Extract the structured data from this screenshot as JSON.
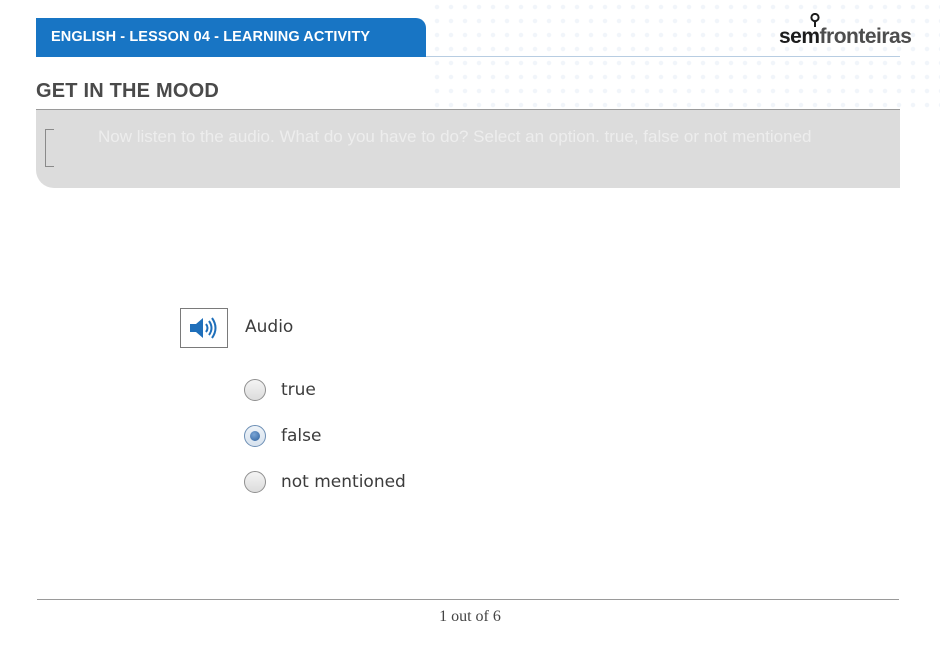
{
  "header": {
    "title": "ENGLISH - LESSON 04 - LEARNING ACTIVITY",
    "logo_part1": "sem",
    "logo_part2": "fronteiras",
    "accent_color": "#1875c4"
  },
  "section": {
    "title": "GET IN THE MOOD"
  },
  "instruction": {
    "text": "Now listen to the audio. What do you have to do? Select an option. true, false or not mentioned"
  },
  "question": {
    "audio_icon": "speaker-icon",
    "audio_label": "Audio",
    "options": [
      {
        "label": "true",
        "selected": false
      },
      {
        "label": "false",
        "selected": true
      },
      {
        "label": "not mentioned",
        "selected": false
      }
    ]
  },
  "footer": {
    "pager": "1 out of 6"
  }
}
